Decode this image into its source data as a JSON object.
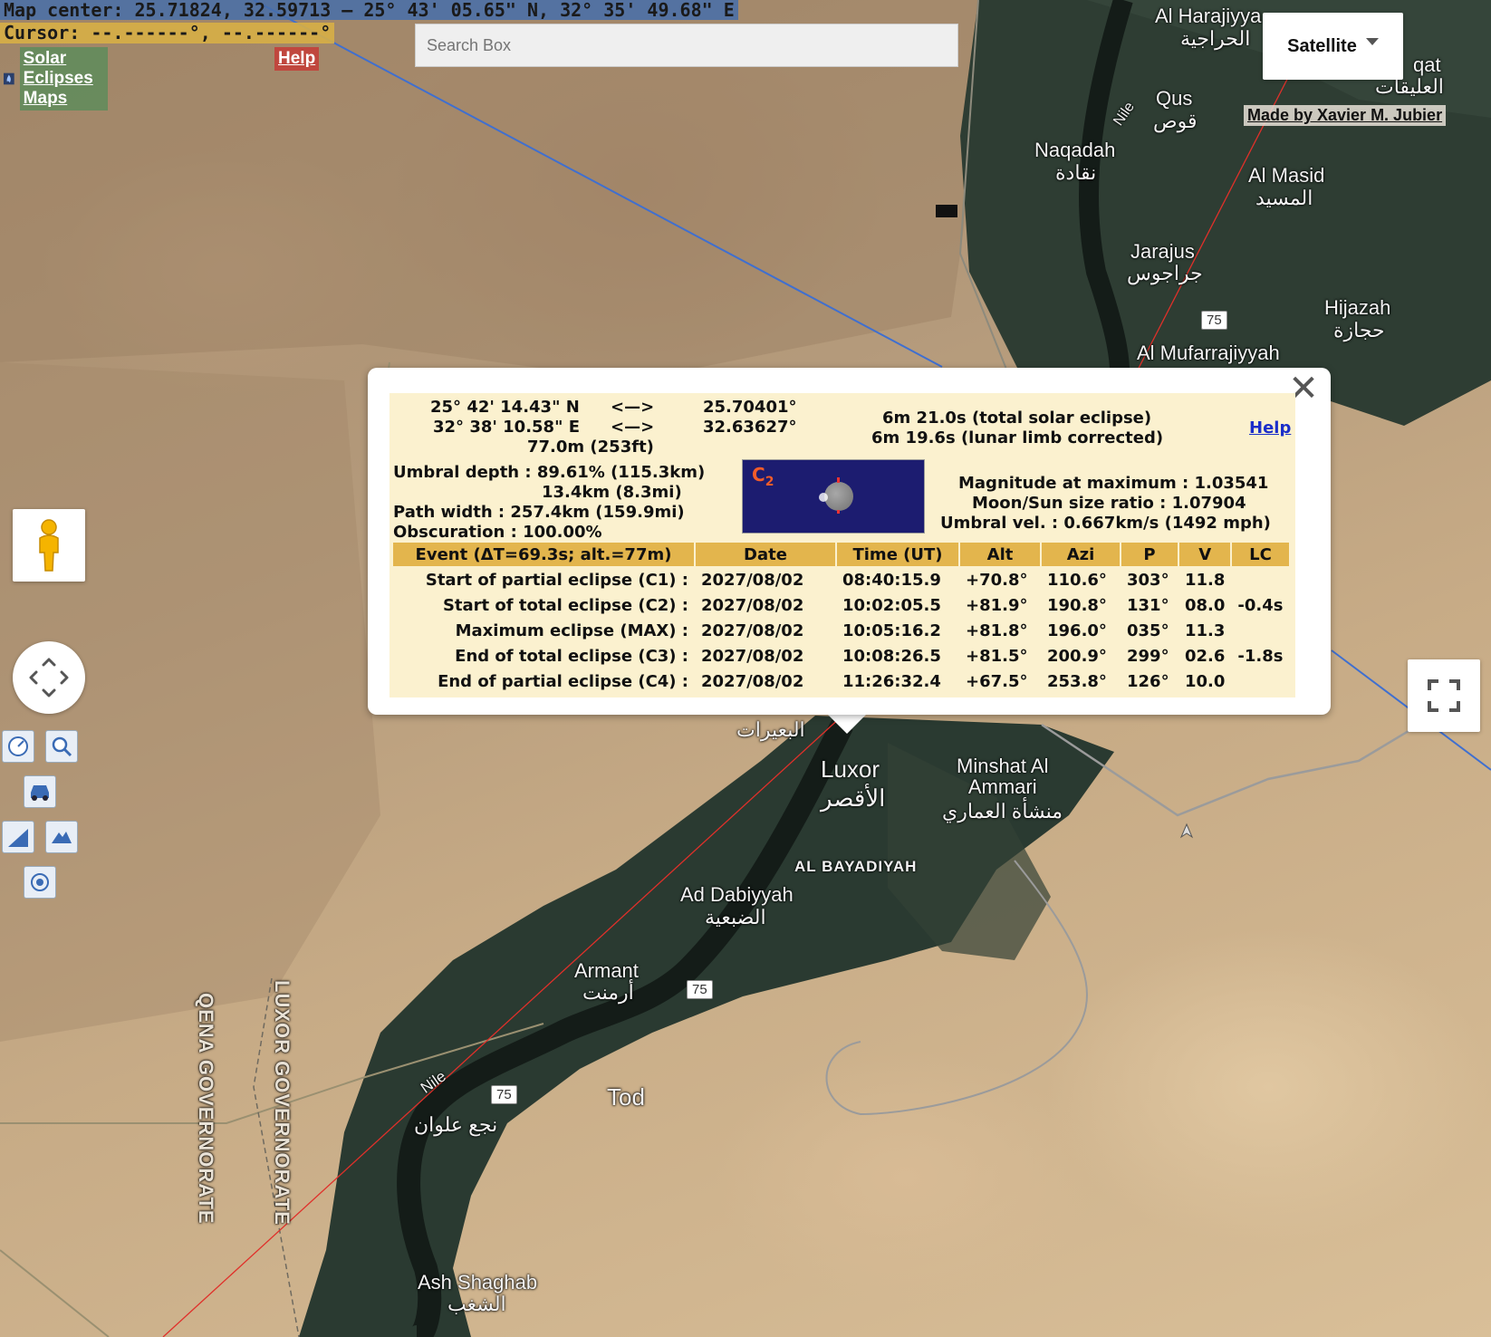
{
  "hud": {
    "map_center": "Map center: 25.71824, 32.59713 — 25° 43' 05.65\" N, 32° 35' 49.68\" E",
    "cursor": "Cursor: --.------°, --.------°",
    "brand_link": "Solar Eclipses Maps",
    "help": "Help"
  },
  "search": {
    "placeholder": "Search Box"
  },
  "map_type": {
    "label": "Satellite"
  },
  "credit": "Made by Xavier M. Jubier",
  "map_labels": {
    "al_harajiyya": "Al Harajiyya",
    "al_harajiyya_ar": "الحراجية",
    "qat": "qat",
    "al_alaiqat_ar": "العليقات",
    "qus": "Qus",
    "qus_ar": "قوص",
    "nile_n": "Nile",
    "naqadah": "Naqadah",
    "naqadah_ar": "نقادة",
    "al_masid": "Al Masid",
    "al_masid_ar": "المسيد",
    "jarajus": "Jarajus",
    "jarajus_ar": "جراجوس",
    "hijazah": "Hijazah",
    "hijazah_ar": "حجازة",
    "al_mufarrajiyyah": "Al Mufarrajiyyah",
    "al_buayrat_ar": "البعيرات",
    "luxor": "Luxor",
    "luxor_ar": "الأقصر",
    "minshat_al_ammari": "Minshat Al\nAmmari",
    "minshat_ar": "منشأة العماري",
    "al_bayadiyah": "AL BAYADIYAH",
    "ad_dabiyyah": "Ad Dabiyyah",
    "ad_dabiyyah_ar": "الضبعية",
    "armant": "Armant",
    "armant_ar": "أرمنت",
    "nile_s": "Nile",
    "tod": "Tod",
    "nag_alwan_ar": "نجع علوان",
    "ash_shaghab": "Ash Shaghab",
    "ash_shaghab_ar": "الشغب",
    "qena_gov": "QENA GOVERNORATE",
    "luxor_gov": "LUXOR GOVERNORATE",
    "road_75_a": "75",
    "road_75_b": "75",
    "road_75_c": "75"
  },
  "popup": {
    "lat_dms": "25° 42' 14.43\" N",
    "lon_dms": "32° 38' 10.58\" E",
    "arrow1": "<—>",
    "arrow2": "<—>",
    "lat_dec": "25.70401°",
    "lon_dec": "32.63627°",
    "elevation": "77.0m (253ft)",
    "duration_total": "6m 21.0s (total solar eclipse)",
    "duration_corrected": "6m 19.6s (lunar limb corrected)",
    "help": "Help",
    "umbral_depth": "Umbral depth : 89.61% (115.3km)",
    "umbral_depth2": "13.4km (8.3mi)",
    "path_width": "Path width : 257.4km (159.9mi)",
    "obscuration": "Obscuration : 100.00%",
    "c2_label": "C",
    "c2_sub": "2",
    "magnitude": "Magnitude at maximum : 1.03541",
    "size_ratio": "Moon/Sun size ratio : 1.07904",
    "umbral_vel": "Umbral vel. : 0.667km/s (1492 mph)",
    "columns": [
      "Event (ΔT=69.3s; alt.=77m)",
      "Date",
      "Time (UT)",
      "Alt",
      "Azi",
      "P",
      "V",
      "LC"
    ],
    "rows": [
      [
        "Start of partial eclipse (C1) :",
        "2027/08/02",
        "08:40:15.9",
        "+70.8°",
        "110.6°",
        "303°",
        "11.8",
        ""
      ],
      [
        "Start of total eclipse (C2) :",
        "2027/08/02",
        "10:02:05.5",
        "+81.9°",
        "190.8°",
        "131°",
        "08.0",
        "-0.4s"
      ],
      [
        "Maximum eclipse (MAX) :",
        "2027/08/02",
        "10:05:16.2",
        "+81.8°",
        "196.0°",
        "035°",
        "11.3",
        ""
      ],
      [
        "End of total eclipse (C3) :",
        "2027/08/02",
        "10:08:26.5",
        "+81.5°",
        "200.9°",
        "299°",
        "02.6",
        "-1.8s"
      ],
      [
        "End of partial eclipse (C4) :",
        "2027/08/02",
        "11:26:32.4",
        "+67.5°",
        "253.8°",
        "126°",
        "10.0",
        ""
      ]
    ]
  },
  "colors": {
    "popup_bg": "#fbf1cf",
    "table_header": "#e3b54d",
    "center_line": "#3f6fd0",
    "eclipse_line": "#e0302a"
  }
}
